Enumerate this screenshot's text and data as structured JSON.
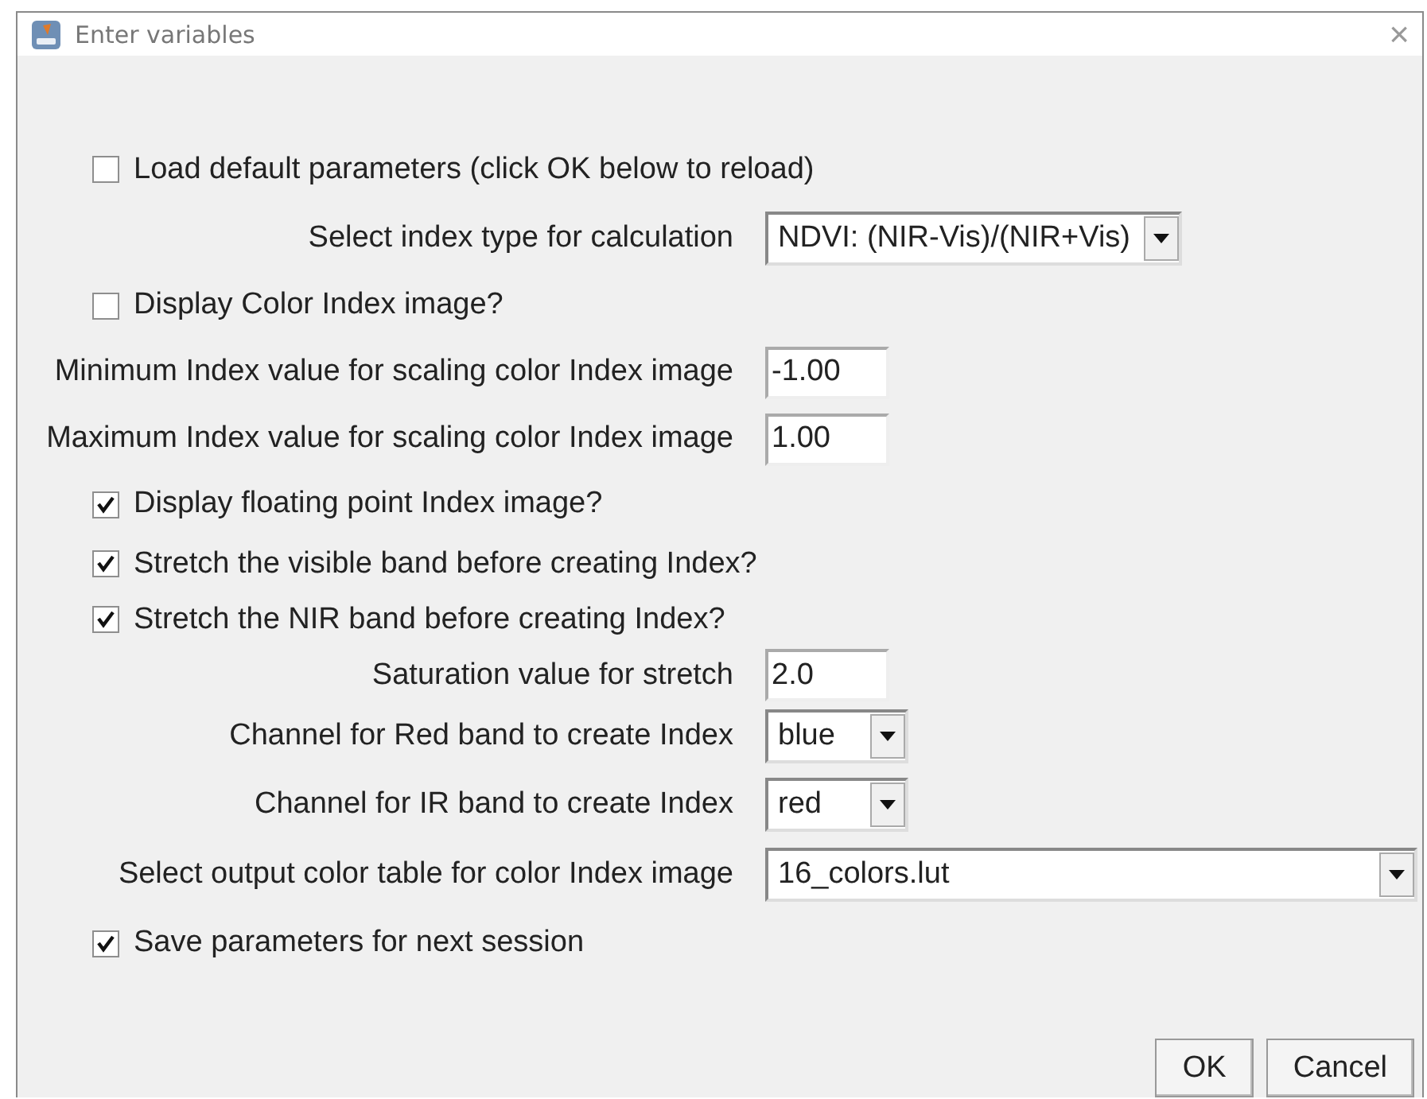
{
  "window": {
    "title": "Enter variables",
    "close": "×"
  },
  "rows": [
    {
      "kind": "checkbox",
      "label": "Load default parameters (click OK below to reload)",
      "checked": false
    },
    {
      "kind": "dropdown",
      "label": "Select index type for calculation",
      "value": "NDVI: (NIR-Vis)/(NIR+Vis)"
    },
    {
      "kind": "checkbox",
      "label": "Display Color Index image?",
      "checked": false
    },
    {
      "kind": "text",
      "label": "Minimum Index value for scaling color Index image",
      "value": "-1.00"
    },
    {
      "kind": "text",
      "label": "Maximum Index value for scaling color Index image",
      "value": "1.00"
    },
    {
      "kind": "checkbox",
      "label": "Display floating point Index image?",
      "checked": true
    },
    {
      "kind": "checkbox",
      "label": "Stretch the visible band before creating Index?",
      "checked": true
    },
    {
      "kind": "checkbox",
      "label": "Stretch the NIR band before creating Index?",
      "checked": true
    },
    {
      "kind": "text",
      "label": "Saturation value for stretch",
      "value": "2.0"
    },
    {
      "kind": "dropdown",
      "label": "Channel for Red band to create Index",
      "value": "blue"
    },
    {
      "kind": "dropdown",
      "label": "Channel for IR band to create Index",
      "value": "red"
    },
    {
      "kind": "dropdown",
      "label": "Select output color table for color Index image",
      "value": "16_colors.lut"
    },
    {
      "kind": "checkbox",
      "label": "Save parameters for next session",
      "checked": true
    }
  ],
  "buttons": [
    "OK",
    "Cancel"
  ]
}
